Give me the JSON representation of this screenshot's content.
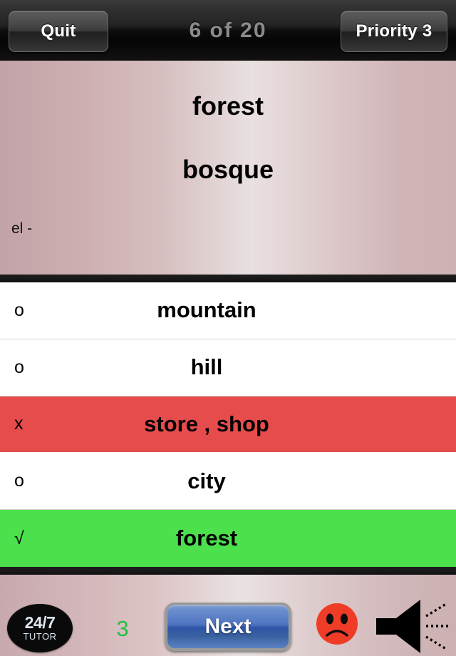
{
  "topbar": {
    "quit_label": "Quit",
    "counter_text": "6  of  20",
    "priority_label": "Priority  3"
  },
  "card": {
    "term": "forest",
    "translation": "bosque",
    "article": "el -",
    "gradient_left_color": "#c2a3a7",
    "gradient_center_color": "#e9e0e0",
    "gradient_right_color": "#cdb1b3"
  },
  "answers": {
    "rows": [
      {
        "mark": "o",
        "label": "mountain",
        "state": "neutral"
      },
      {
        "mark": "o",
        "label": "hill",
        "state": "neutral"
      },
      {
        "mark": "x",
        "label": "store , shop",
        "state": "wrong"
      },
      {
        "mark": "o",
        "label": "city",
        "state": "neutral"
      },
      {
        "mark": "√",
        "label": "forest",
        "state": "correct"
      }
    ],
    "wrong_color": "#e64c4c",
    "correct_color": "#4ce04c",
    "neutral_color": "#ffffff"
  },
  "bottombar": {
    "logo_primary": "24/7",
    "logo_secondary": "TUTOR",
    "streak_count": "3",
    "next_label": "Next",
    "feedback_icon": "sad-face-icon",
    "audio_icon": "speaker-icon",
    "streak_color": "#1fbf43"
  }
}
